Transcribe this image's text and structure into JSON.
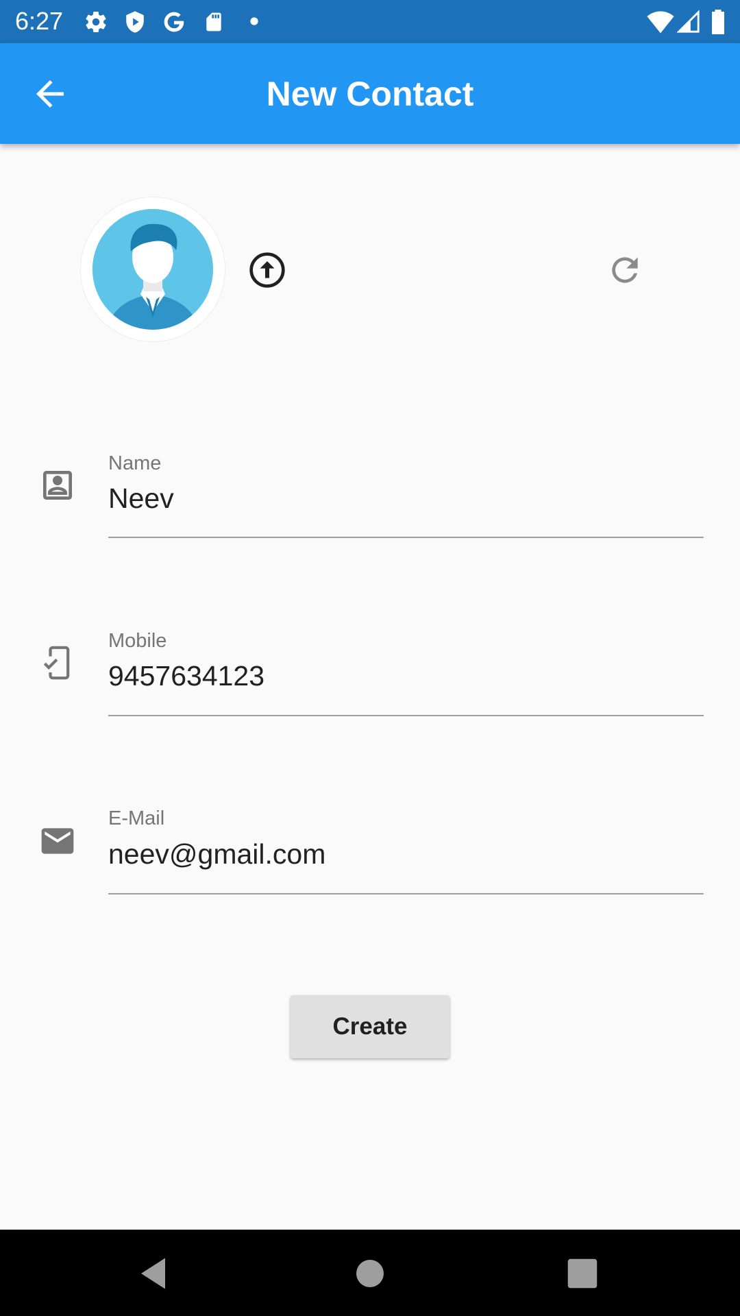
{
  "status_bar": {
    "time": "6:27",
    "left_icons": [
      "gear-icon",
      "shield-icon",
      "google-g-icon",
      "sd-card-icon",
      "notification-dot-icon"
    ],
    "right_icons": [
      "wifi-icon",
      "signal-icon",
      "battery-icon"
    ]
  },
  "app_bar": {
    "title": "New Contact",
    "back_icon": "arrow-back-icon",
    "color": "#2196f3"
  },
  "avatar": {
    "icon": "person-avatar",
    "upload_icon": "upload-circle-icon",
    "reset_icon": "refresh-icon"
  },
  "form": {
    "name": {
      "label": "Name",
      "value": "Neev",
      "icon": "contact-card-icon"
    },
    "mobile": {
      "label": "Mobile",
      "value": "9457634123",
      "icon": "phone-check-icon"
    },
    "email": {
      "label": "E-Mail",
      "value": "neev@gmail.com",
      "icon": "mail-icon"
    }
  },
  "actions": {
    "create_label": "Create"
  },
  "nav_bar": {
    "icons": [
      "nav-back-icon",
      "nav-home-icon",
      "nav-recents-icon"
    ]
  }
}
